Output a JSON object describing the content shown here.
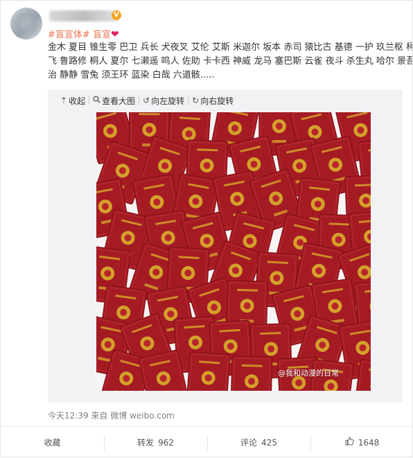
{
  "post": {
    "verified_badge": "V",
    "tagline": {
      "topic": "#盲宣体#",
      "suffix": "盲宣",
      "heart": "❤"
    },
    "lines": [
      "金木 夏目 锥生零 巴卫 兵长 犬夜叉 艾伦 艾斯 米迦尔 坂本 赤司 猿比古 基德 一护 玖兰枢 柯南 路",
      "飞 鲁路修 桐人 夏尔 七濑遥 鸣人 佐助 卡卡西 神威 龙马 塞巴斯 云雀 夜斗 杀生丸 哈尔 景吾 太宰",
      "治 静静 雪兔 须王环 蓝染 白哉 六道骸....."
    ],
    "meta": "今天12:39 来自 微博 weibo.com"
  },
  "media": {
    "toolbar": {
      "collapse": "收起",
      "view_large": "查看大图",
      "rotate_left": "向左旋转",
      "rotate_right": "向右旋转"
    },
    "watermark": "@我和动漫的日常"
  },
  "actions": {
    "favorite": "收藏",
    "repost_label": "转发",
    "repost_count": "962",
    "comment_label": "评论",
    "comment_count": "425",
    "like_count": "1648"
  },
  "colors": {
    "topic": "#eb7350",
    "certificate": "#a51b24",
    "emblem": "#d4a02a"
  }
}
